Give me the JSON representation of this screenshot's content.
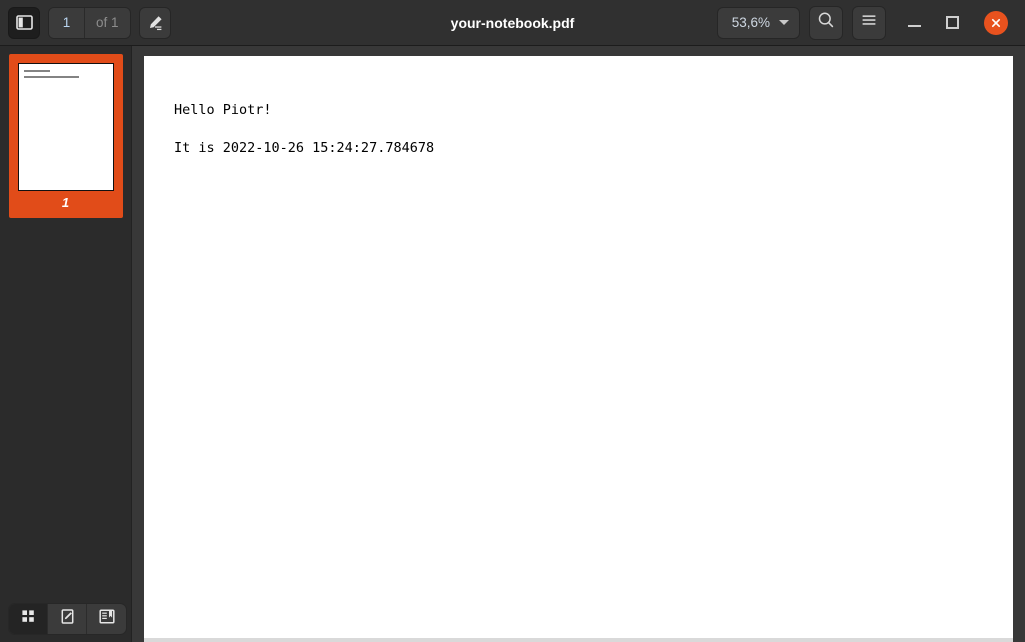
{
  "window": {
    "title": "your-notebook.pdf"
  },
  "toolbar": {
    "sidebar_toggle_icon": "sidebar-panel-icon",
    "page_current": "1",
    "page_total_label": "of 1",
    "annotate_icon": "pen-annotate-icon",
    "zoom_level": "53,6%",
    "zoom_caret_icon": "chevron-down-icon",
    "search_icon": "search-icon",
    "menu_icon": "hamburger-menu-icon",
    "minimize_icon": "minimize-icon",
    "maximize_icon": "maximize-icon",
    "close_icon": "close-icon"
  },
  "sidebar": {
    "thumbnails": [
      {
        "page_label": "1",
        "selected": true
      }
    ],
    "modes": [
      {
        "name": "thumbnails",
        "icon": "grid-thumbnails-icon",
        "active": true
      },
      {
        "name": "annotations",
        "icon": "pen-edit-icon",
        "active": false
      },
      {
        "name": "outline",
        "icon": "bookmark-outline-icon",
        "active": false
      }
    ]
  },
  "document": {
    "lines": [
      "Hello Piotr!",
      "It is 2022-10-26 15:24:27.784678"
    ]
  },
  "colors": {
    "accent_orange": "#e14c19",
    "close_button": "#e8521e",
    "headerbar": "#303030",
    "sidebar": "#2b2b2b",
    "viewer_background": "#383838",
    "page": "#ffffff",
    "page_number_text": "#b9d4ef"
  }
}
